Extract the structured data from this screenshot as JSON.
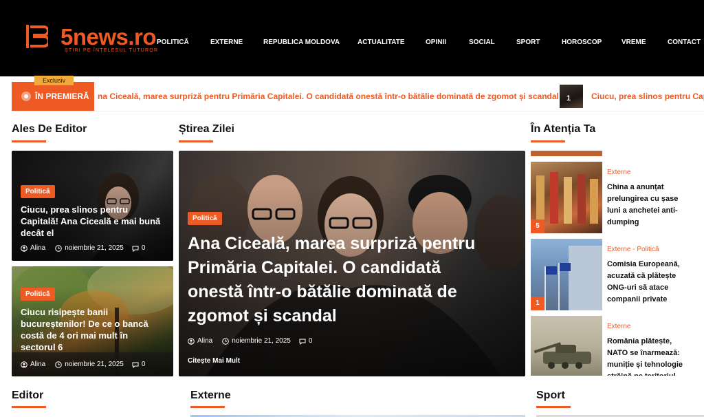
{
  "brand": {
    "name": "5news.ro",
    "tagline": "ȘTIRI PE ÎNȚELESUL TUTUROR",
    "accent": "#ee5a24"
  },
  "nav": [
    "POLITICĂ",
    "EXTERNE",
    "REPUBLICA MOLDOVA",
    "ACTUALITATE",
    "OPINII",
    "SOCIAL",
    "SPORT",
    "HOROSCOP",
    "VREME",
    "CONTACT"
  ],
  "ticker": {
    "exclusive_label": "Exclusiv",
    "label": "ÎN PREMIERĂ",
    "headline_1": "na Ciceală, marea surpriză pentru Primăria Capitalei. O candidată onestă într-o bătălie dominată de zgomot și scandal",
    "thumb_number": "1",
    "headline_2": "Ciucu, prea slinos pentru Capi"
  },
  "sections": {
    "editor_pick": "Ales De Editor",
    "story_of_day": "Știrea Zilei",
    "attention": "În Atenția Ta",
    "editor": "Editor",
    "externe": "Externe",
    "sport": "Sport"
  },
  "editor_cards": [
    {
      "category": "Politică",
      "title": "Ciucu, prea slinos pentru Capitală! Ana Ciceală e mai bună decât el",
      "author": "Alina",
      "date": "noiembrie 21, 2025",
      "comments": "0"
    },
    {
      "category": "Politică",
      "title": "Ciucu risipește banii bucureștenilor! De ce o bancă costă de 4 ori mai mult în sectorul 6",
      "author": "Alina",
      "date": "noiembrie 21, 2025",
      "comments": "0"
    }
  ],
  "hero": {
    "category": "Politică",
    "title": "Ana Ciceală, marea surpriză pentru Primăria Capitalei. O candidată onestă într-o bătălie dominată de zgomot și scandal",
    "author": "Alina",
    "date": "noiembrie 21, 2025",
    "comments": "0",
    "read_more": "Citește Mai Mult"
  },
  "attention_items": [
    {
      "number": "5",
      "category": "Externe",
      "title": "China a anunțat prelungirea cu șase luni a anchetei anti-dumping"
    },
    {
      "number": "1",
      "category": "Externe -  Politică",
      "title": "Comisia Europeană, acuzată că plătește ONG-uri să atace companii private"
    },
    {
      "number": "",
      "category": "Externe",
      "title": "România plătește, NATO se înarmează: muniție și tehnologie străină pe teritoriul"
    }
  ]
}
